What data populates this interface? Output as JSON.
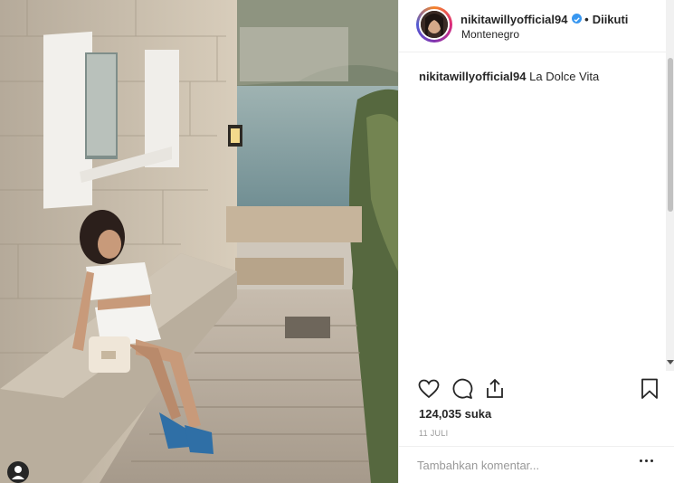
{
  "post": {
    "username": "nikitawillyofficial94",
    "verified": true,
    "follow_status": "Diikuti",
    "location": "Montenegro",
    "caption_user": "nikitawillyofficial94",
    "caption_text": "La Dolce Vita",
    "likes": "124,035 suka",
    "date": "11 JULI",
    "comment_placeholder": "Tambahkan komentar...",
    "image_desc": "photo"
  },
  "icons": {
    "like": "heart-icon",
    "comment": "comment-icon",
    "share": "share-icon",
    "save": "bookmark-icon",
    "more": "more-options-icon",
    "user_tag": "user-tag-icon"
  },
  "colors": {
    "text": "#262626",
    "muted": "#999999",
    "verified": "#3897f0",
    "border": "#efefef"
  }
}
